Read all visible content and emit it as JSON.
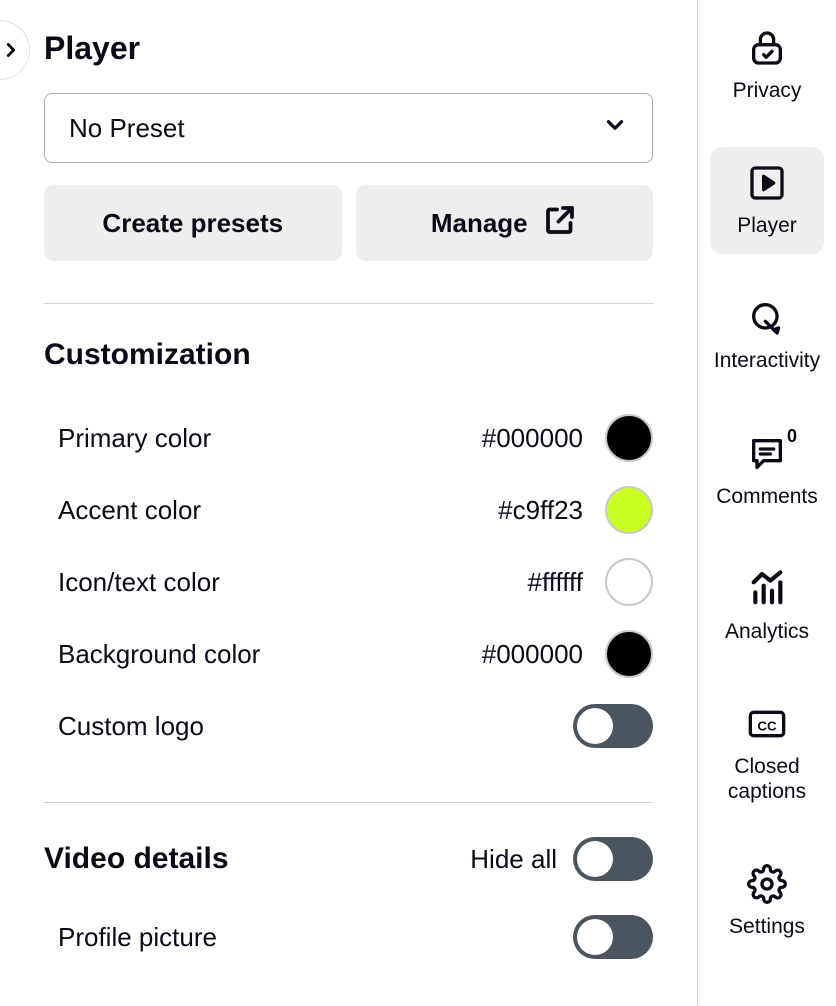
{
  "page": {
    "title": "Player"
  },
  "preset": {
    "selected": "No Preset",
    "create_label": "Create presets",
    "manage_label": "Manage"
  },
  "customization": {
    "title": "Customization",
    "primary": {
      "label": "Primary color",
      "hex": "#000000",
      "swatch": "#000000"
    },
    "accent": {
      "label": "Accent color",
      "hex": "#c9ff23",
      "swatch": "#c9ff23"
    },
    "icon_text": {
      "label": "Icon/text color",
      "hex": "#ffffff",
      "swatch": "#ffffff"
    },
    "background": {
      "label": "Background color",
      "hex": "#000000",
      "swatch": "#000000"
    },
    "custom_logo": {
      "label": "Custom logo",
      "enabled": false
    }
  },
  "video_details": {
    "title": "Video details",
    "hide_all": {
      "label": "Hide all",
      "enabled": false
    },
    "profile_picture": {
      "label": "Profile picture",
      "enabled": false
    }
  },
  "rail": {
    "privacy": "Privacy",
    "player": "Player",
    "interactivity": "Interactivity",
    "comments": "Comments",
    "comments_count": "0",
    "analytics": "Analytics",
    "closed_captions": "Closed captions",
    "settings": "Settings"
  }
}
